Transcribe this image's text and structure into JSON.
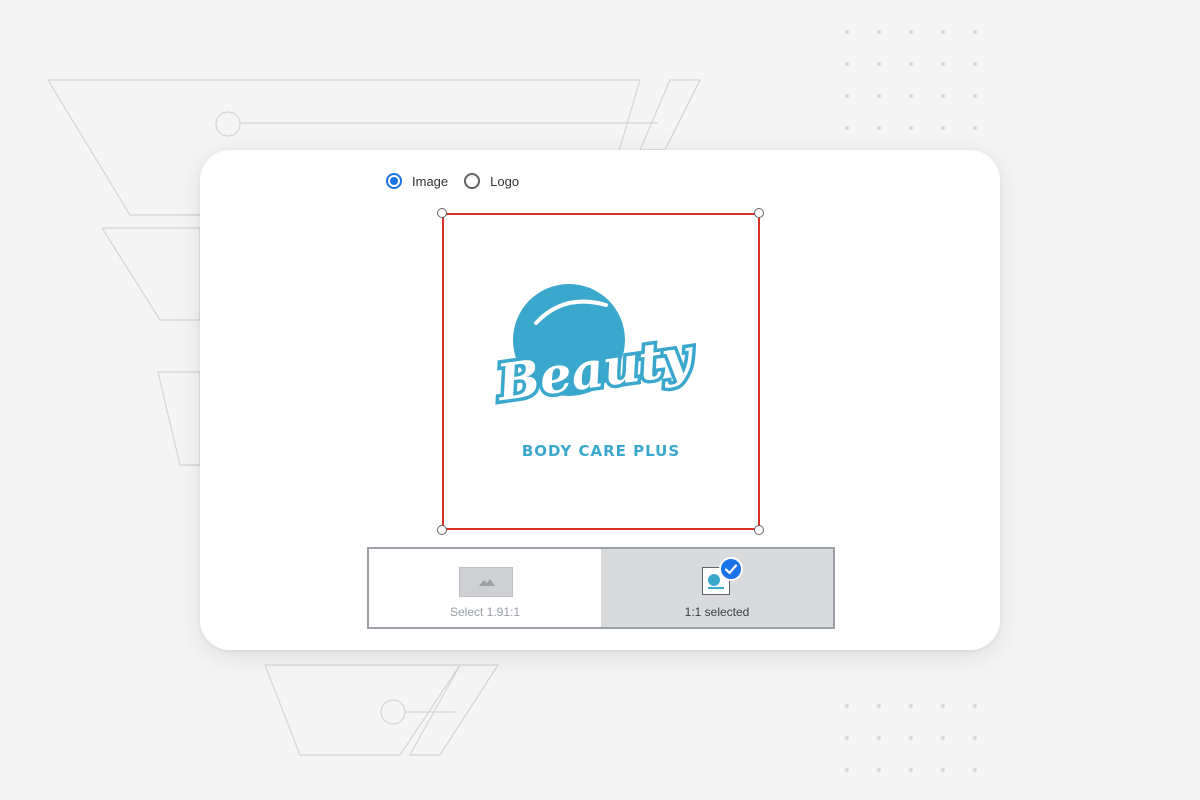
{
  "asset_type_options": [
    {
      "label": "Image",
      "selected": true
    },
    {
      "label": "Logo",
      "selected": false
    }
  ],
  "preview": {
    "logo_text_main": "Beauty",
    "logo_text_sub": "BODY CARE PLUS",
    "brand_color": "#3aa7cc",
    "crop_border_color": "#d93025"
  },
  "aspect_ratios": [
    {
      "label": "Select 1.91:1",
      "selected": false,
      "thumbnail_icon": "mountain-image-icon"
    },
    {
      "label": "1:1 selected",
      "selected": true,
      "thumbnail_icon": "logo-thumbnail-icon",
      "badge_icon": "checkmark-icon"
    }
  ],
  "colors": {
    "accent": "#1a73e8",
    "selected_tile": "#d9dadc",
    "card_background": "#ffffff",
    "page_background": "#f5f5f6"
  }
}
